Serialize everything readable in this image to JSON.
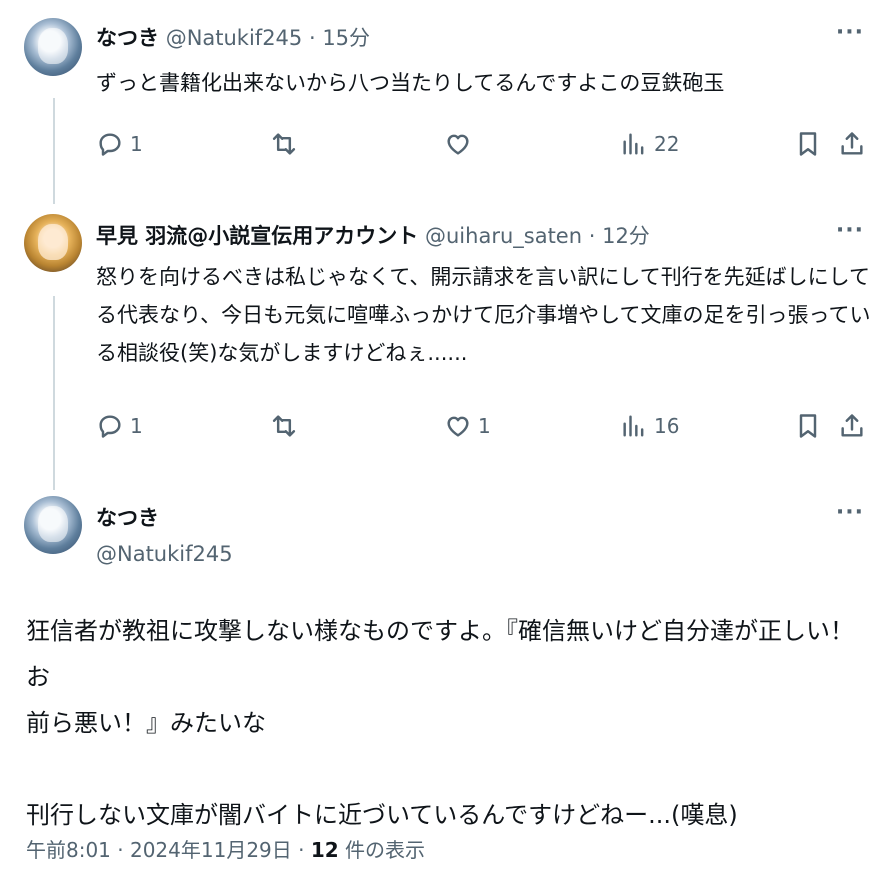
{
  "tweets": [
    {
      "name": "なつき",
      "handle": "@Natukif245",
      "time": "· 15分",
      "text": "ずっと書籍化出来ないから八つ当たりしてるんですよこの豆鉄砲玉",
      "reply_count": "1",
      "retweet_count": "",
      "like_count": "",
      "view_count": "22"
    },
    {
      "name": "早見 羽流@小説宣伝用アカウント",
      "handle": "@uiharu_saten",
      "time": "· 12分",
      "text_lines": [
        "怒りを向けるべきは私じゃなくて、開示請求を言い訳にして刊行を先延ばしにして",
        "る代表なり、今日も元気に喧嘩ふっかけて厄介事増やして文庫の足を引っ張ってい",
        "る相談役(笑)な気がしますけどねぇ......"
      ],
      "reply_count": "1",
      "retweet_count": "",
      "like_count": "1",
      "view_count": "16"
    }
  ],
  "main_tweet": {
    "name": "なつき",
    "handle": "@Natukif245",
    "text_lines": [
      "狂信者が教祖に攻撃しない様なものですよ。『確信無いけど自分達が正しい！お",
      "前ら悪い！』みたいな",
      "",
      "刊行しない文庫が闇バイトに近づいているんですけどねー...(嘆息)"
    ],
    "timestamp": "午前8:01 · 2024年11月29日 · ",
    "views_number": "12",
    "views_label": " 件の表示"
  },
  "more_label": "···",
  "icons": [
    "reply-icon",
    "retweet-icon",
    "like-icon",
    "views-icon",
    "bookmark-icon",
    "share-icon",
    "more-icon"
  ]
}
